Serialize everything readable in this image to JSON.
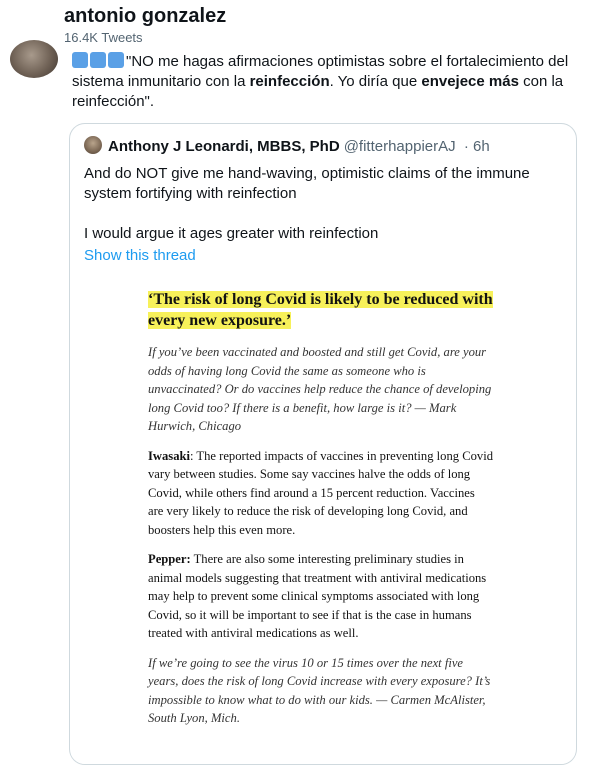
{
  "author": {
    "name": "antonio gonzalez",
    "tweet_count": "16.4K Tweets"
  },
  "tweet": {
    "emoji": [
      "blue-square-icon",
      "blue-square-icon",
      "blue-square-icon"
    ],
    "text_1": "\"NO me hagas afirmaciones optimistas sobre el fortalecimiento del sistema inmunitario con la ",
    "bold_1": "reinfección",
    "text_2": ". Yo diría que ",
    "bold_2": "envejece más",
    "text_3": " con la reinfección\"."
  },
  "quoted_tweet": {
    "name": "Anthony J Leonardi, MBBS, PhD",
    "handle": "@fitterhappierAJ",
    "time": "· 6h",
    "line_1": "And do NOT give me hand-waving, optimistic claims of the immune system fortifying with reinfection",
    "line_2": "I would argue it ages greater with reinfection",
    "show_thread": "Show this thread"
  },
  "article": {
    "headline": "‘The risk of long Covid is likely to be reduced with every new exposure.’",
    "q1": "If you’ve been vaccinated and boosted and still get Covid, are your odds of having long Covid the same as someone who is unvaccinated? Or do vaccines help reduce the chance of developing long Covid too? If there is a benefit, how large is it? — Mark Hurwich, Chicago",
    "a1_speaker": "Iwasaki",
    "a1_text": ": The reported impacts of vaccines in preventing long Covid vary between studies. Some say vaccines halve the odds of long Covid, while others find around a 15 percent reduction. Vaccines are very likely to reduce the risk of developing long Covid, and boosters help this even more.",
    "a2_speaker": "Pepper:",
    "a2_text": " There are also some interesting preliminary studies in animal models suggesting that treatment with antiviral medications may help to prevent some clinical symptoms associated with long Covid, so it will be important to see if that is the case in humans treated with antiviral medications as well.",
    "q2": "If we’re going to see the virus 10 or 15 times over the next five years, does the risk of long Covid increase with every exposure? It’s impossible to know what to do with our kids. — Carmen McAlister, South Lyon, Mich."
  }
}
